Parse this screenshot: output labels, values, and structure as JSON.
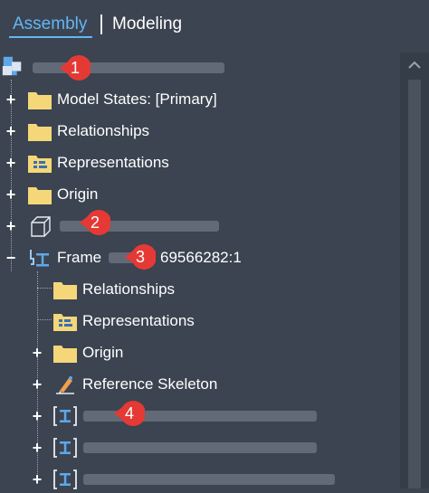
{
  "tabs": [
    {
      "label": "Assembly",
      "active": true
    },
    {
      "label": "Modeling",
      "active": false
    }
  ],
  "tree": {
    "root": {
      "icon": "assembly-icon",
      "label_hidden": true
    },
    "items": [
      {
        "label": "Model States: [Primary]",
        "icon": "folder-icon"
      },
      {
        "label": "Relationships",
        "icon": "folder-icon"
      },
      {
        "label": "Representations",
        "icon": "representations-folder-icon"
      },
      {
        "label": "Origin",
        "icon": "folder-icon"
      },
      {
        "label": "",
        "icon": "part-cube-icon"
      },
      {
        "label": "Frame",
        "suffix": "69566282:1",
        "icon": "frame-icon"
      },
      {
        "label": "Relationships",
        "icon": "folder-icon"
      },
      {
        "label": "Representations",
        "icon": "representations-folder-icon"
      },
      {
        "label": "Origin",
        "icon": "folder-icon"
      },
      {
        "label": "Reference Skeleton",
        "icon": "reference-skeleton-icon"
      },
      {
        "label": "",
        "icon": "frame-member-icon"
      },
      {
        "label": "",
        "icon": "frame-member-icon"
      },
      {
        "label": "",
        "icon": "frame-member-icon"
      }
    ]
  },
  "callouts": [
    "1",
    "2",
    "3",
    "4"
  ],
  "colors": {
    "background": "#3b4450",
    "accent": "#64b5f6",
    "callout": "#e53935",
    "folder": "#f5d77a"
  }
}
